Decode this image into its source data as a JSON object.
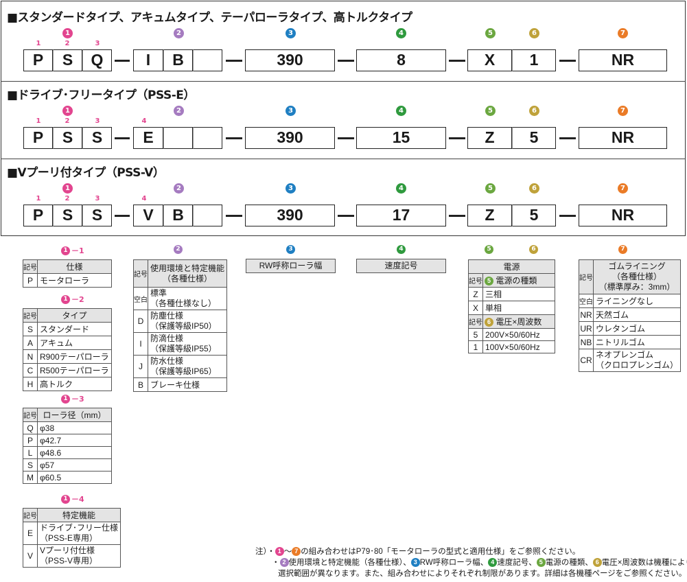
{
  "sections": [
    {
      "title": "■スタンダードタイプ、アキュムタイプ、テーパローラタイプ、高トルクタイプ",
      "chars": [
        "P",
        "S",
        "Q",
        "I",
        "B",
        "",
        "390",
        "8",
        "X",
        "1",
        "NR"
      ]
    },
    {
      "title": "■ドライブ･フリータイプ（PSS-E）",
      "chars": [
        "P",
        "S",
        "S",
        "E",
        "",
        "",
        "390",
        "15",
        "Z",
        "5",
        "NR"
      ]
    },
    {
      "title": "■Vプーリ付タイプ（PSS-V）",
      "chars": [
        "P",
        "S",
        "S",
        "V",
        "B",
        "",
        "390",
        "17",
        "Z",
        "5",
        "NR"
      ]
    }
  ],
  "nums": [
    "1",
    "2",
    "3",
    "4",
    "5",
    "6",
    "7"
  ],
  "subs": [
    "1",
    "2",
    "3",
    "4"
  ],
  "legend": {
    "l11": {
      "label": "－1",
      "h_key": "記号",
      "h_val": "仕様",
      "rows": [
        [
          "P",
          "モータローラ"
        ]
      ]
    },
    "l12": {
      "label": "－2",
      "h_key": "記号",
      "h_val": "タイプ",
      "rows": [
        [
          "S",
          "スタンダード"
        ],
        [
          "A",
          "アキュム"
        ],
        [
          "N",
          "R900テーパローラ"
        ],
        [
          "C",
          "R500テーパローラ"
        ],
        [
          "H",
          "高トルク"
        ]
      ]
    },
    "l13": {
      "label": "－3",
      "h_key": "記号",
      "h_val": "ローラ径（mm）",
      "rows": [
        [
          "Q",
          "φ38"
        ],
        [
          "P",
          "φ42.7"
        ],
        [
          "L",
          "φ48.6"
        ],
        [
          "S",
          "φ57"
        ],
        [
          "M",
          "φ60.5"
        ]
      ]
    },
    "l14": {
      "label": "－4",
      "h_key": "記号",
      "h_val": "特定機能",
      "rows": [
        [
          "E",
          "ドライブ･フリー仕様",
          "（PSS-E専用）"
        ],
        [
          "V",
          "Vプーリ付仕様",
          "（PSS-V専用）"
        ]
      ]
    },
    "l2": {
      "h_key": "記号",
      "h_val1": "使用環境と特定機能",
      "h_val2": "（各種仕様）",
      "rows": [
        [
          "空白",
          "標準",
          "（各種仕様なし）"
        ],
        [
          "D",
          "防塵仕様",
          "（保護等級IP50）"
        ],
        [
          "I",
          "防滴仕様",
          "（保護等級IP55）"
        ],
        [
          "J",
          "防水仕様",
          "（保護等級IP65）"
        ],
        [
          "B",
          "ブレーキ仕様",
          ""
        ]
      ]
    },
    "l3": {
      "h": "RW呼称ローラ幅"
    },
    "l4": {
      "h": "速度記号"
    },
    "l56": {
      "h": "電源",
      "k": "記号",
      "h5": "電源の種類",
      "rows5": [
        [
          "Z",
          "三相"
        ],
        [
          "X",
          "単相"
        ]
      ],
      "h6": "電圧×周波数",
      "rows6": [
        [
          "5",
          "200V×50/60Hz"
        ],
        [
          "1",
          "100V×50/60Hz"
        ]
      ]
    },
    "l7": {
      "h_key": "記号",
      "h1": "ゴムライニング",
      "h2": "（各種仕様）",
      "h3": "（標準厚み：3mm）",
      "rows": [
        [
          "空白",
          "ライニングなし",
          ""
        ],
        [
          "NR",
          "天然ゴム",
          ""
        ],
        [
          "UR",
          "ウレタンゴム",
          ""
        ],
        [
          "NB",
          "ニトリルゴム",
          ""
        ],
        [
          "CR",
          "ネオプレンゴム",
          "（クロロプレンゴム）"
        ]
      ]
    }
  },
  "notes": {
    "prefix": "注）・",
    "n1": "の組み合わせはP79･80「モータローラの型式と適用仕様」をご参照ください。",
    "tilde": "～",
    "bullet": "・",
    "n2a": "使用環境と特定機能（各種仕様）、",
    "n2b": "RW呼称ローラ幅、",
    "n2c": "速度記号、",
    "n2d": "電源の種類、",
    "n2e": "電圧×周波数は機種により",
    "n3": "選択範囲が異なります。また、組み合わせによりそれぞれ制限があります。詳細は各機種ページをご参照ください。"
  },
  "colors": {
    "c1": "#e2458f",
    "c2": "#a57bc0",
    "c3": "#1f7fc2",
    "c4": "#2f9a3e",
    "c5": "#6ba740",
    "c6": "#bfa23a",
    "c7": "#ea7b27"
  }
}
